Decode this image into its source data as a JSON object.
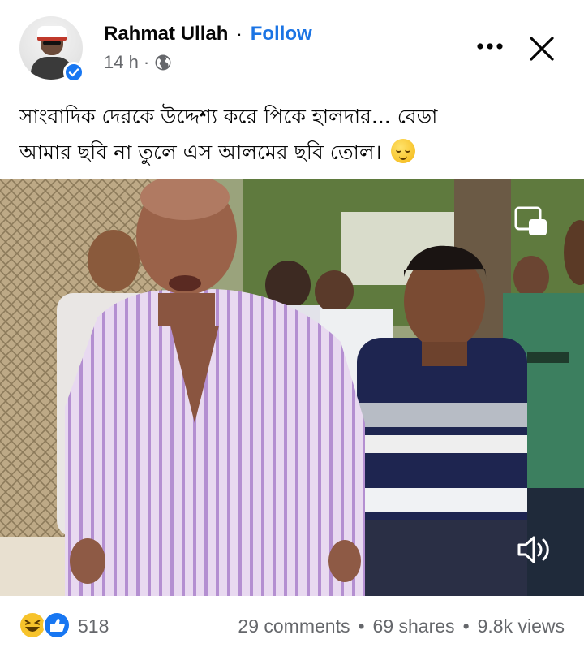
{
  "post": {
    "author": "Rahmat Ullah",
    "separator": "·",
    "follow_label": "Follow",
    "time": "14 h",
    "meta_separator": "·",
    "privacy_icon": "globe-icon",
    "text_line1": "সাংবাদিক দেরকে উদ্দেশ্য করে পিকে হালদার... বেডা",
    "text_line2": "আমার ছবি না তুলে এস আলমের ছবি তোল।",
    "emoji": "relieved-face-emoji"
  },
  "header_actions": {
    "more_icon": "more-horizontal-icon",
    "close_icon": "close-icon"
  },
  "video": {
    "pip_icon": "picture-in-picture-icon",
    "mute_icon": "speaker-muted-icon"
  },
  "footer": {
    "reactions_count": "518",
    "comments": "29 comments",
    "shares": "69 shares",
    "views": "9.8k views",
    "stat_separator": "•",
    "reaction_icons": [
      "haha-reaction-icon",
      "like-reaction-icon"
    ]
  },
  "colors": {
    "link_blue": "#1b74e4",
    "secondary_text": "#65676b",
    "like_blue": "#1877f2",
    "haha_yellow": "#f7c32b"
  }
}
